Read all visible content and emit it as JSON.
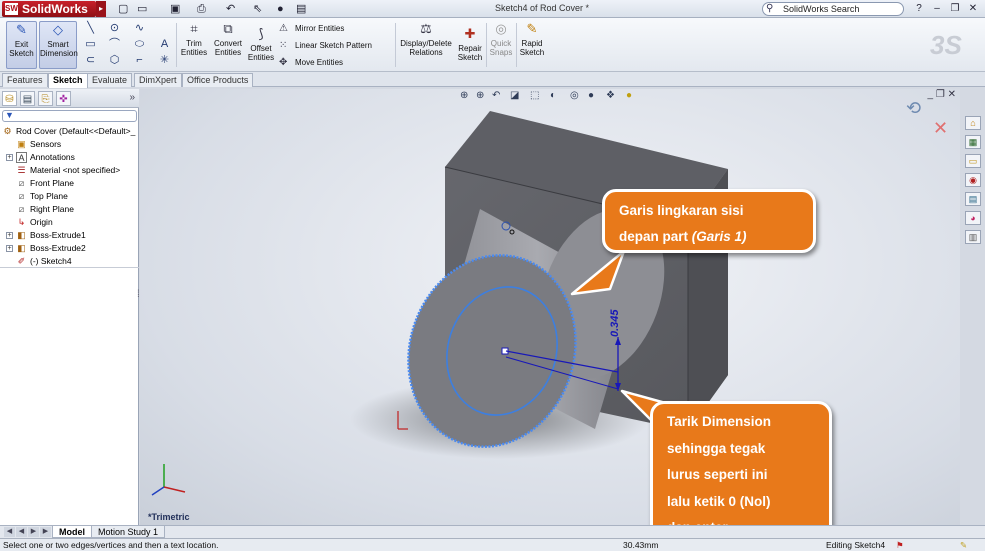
{
  "titlebar": {
    "app_name": "SolidWorks",
    "document_title": "Sketch4 of Rod Cover *",
    "search_placeholder": "SolidWorks Search",
    "menu_arrow": "▸",
    "quick_access": [
      "new-icon",
      "open-icon",
      "save-icon",
      "print-icon",
      "undo-icon",
      "select-icon",
      "rebuild-icon",
      "options-icon"
    ],
    "window_buttons": [
      "?",
      "–",
      "❐",
      "✕"
    ]
  },
  "command_manager": {
    "exit_sketch": "Exit Sketch",
    "smart_dimension": "Smart Dimension",
    "trim_entities": "Trim Entities",
    "convert_entities": "Convert Entities",
    "offset_entities": "Offset Entities",
    "mirror_entities": "Mirror Entities",
    "linear_sketch_pattern": "Linear Sketch Pattern",
    "move_entities": "Move Entities",
    "display_delete_relations": "Display/Delete Relations",
    "repair_sketch": "Repair Sketch",
    "quick_snaps": "Quick Snaps",
    "rapid_sketch": "Rapid Sketch"
  },
  "tabs": [
    "Features",
    "Sketch",
    "Evaluate",
    "DimXpert",
    "Office Products"
  ],
  "active_tab": "Sketch",
  "feature_tree": {
    "root": "Rod Cover  (Default<<Default>_",
    "items": [
      "Sensors",
      "Annotations",
      "Material <not specified>",
      "Front Plane",
      "Top Plane",
      "Right Plane",
      "Origin",
      "Boss-Extrude1",
      "Boss-Extrude2",
      "(-) Sketch4"
    ]
  },
  "graphics": {
    "dimension_value": "0.345",
    "view_label": "*Trimetric",
    "accent_sketch": "#3d7fe0",
    "accent_dimension": "#1818b8",
    "callout_color": "#e8791a"
  },
  "callouts": {
    "top": {
      "line1": "Garis lingkaran sisi",
      "line2_prefix": "depan part ",
      "line2_italic": "(Garis 1)"
    },
    "bottom": {
      "lines": [
        "Tarik Dimension",
        "sehingga tegak",
        "lurus seperti ini",
        "lalu ketik 0 (Nol)",
        "dan enter."
      ]
    }
  },
  "bottom_tabs": [
    "Model",
    "Motion Study 1"
  ],
  "status": {
    "message": "Select one or two edges/vertices and then a text location.",
    "measurement": "30.43mm",
    "editing": "Editing Sketch4"
  }
}
